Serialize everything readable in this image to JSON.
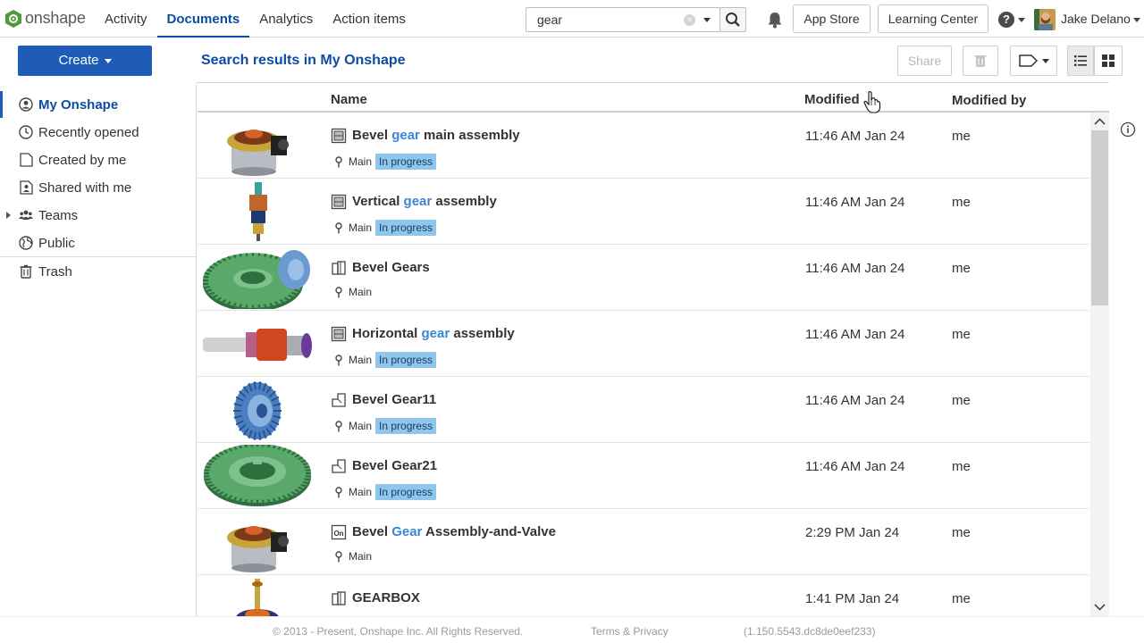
{
  "app": {
    "logo_text": "onshape"
  },
  "nav": [
    "Activity",
    "Documents",
    "Analytics",
    "Action items"
  ],
  "search": {
    "value": "gear",
    "clear_glyph": "×"
  },
  "topbar": {
    "app_store": "App Store",
    "learning_center": "Learning Center",
    "help_glyph": "?",
    "user_name": "Jake Delano"
  },
  "sidebar": {
    "create_label": "Create",
    "items": [
      "My Onshape",
      "Recently opened",
      "Created by me",
      "Shared with me",
      "Teams",
      "Public",
      "Trash"
    ]
  },
  "main": {
    "title": "Search results in My Onshape",
    "share_label": "Share",
    "columns": {
      "name": "Name",
      "modified": "Modified",
      "modified_by": "Modified by"
    }
  },
  "rows": [
    {
      "name_parts": [
        "Bevel ",
        "gear",
        " main assembly"
      ],
      "type_icon": "assembly-doc-icon",
      "branch": "Main",
      "status": "In progress",
      "modified": "11:46 AM Jan 24",
      "modified_by": "me",
      "thumb": "gear-housing-assembly"
    },
    {
      "name_parts": [
        "Vertical ",
        "gear",
        " assembly"
      ],
      "type_icon": "assembly-doc-icon",
      "branch": "Main",
      "status": "In progress",
      "modified": "11:46 AM Jan 24",
      "modified_by": "me",
      "thumb": "vertical-shaft"
    },
    {
      "name_parts": [
        "Bevel Gears",
        "",
        ""
      ],
      "type_icon": "document-icon",
      "branch": "Main",
      "status": "",
      "modified": "11:46 AM Jan 24",
      "modified_by": "me",
      "thumb": "bevel-gear-pair"
    },
    {
      "name_parts": [
        "Horizontal ",
        "gear",
        " assembly"
      ],
      "type_icon": "assembly-doc-icon",
      "branch": "Main",
      "status": "In progress",
      "modified": "11:46 AM Jan 24",
      "modified_by": "me",
      "thumb": "horizontal-shaft"
    },
    {
      "name_parts": [
        "Bevel Gear11",
        "",
        ""
      ],
      "type_icon": "part-studio-icon",
      "branch": "Main",
      "status": "In progress",
      "modified": "11:46 AM Jan 24",
      "modified_by": "me",
      "thumb": "small-bevel-gear"
    },
    {
      "name_parts": [
        "Bevel Gear21",
        "",
        ""
      ],
      "type_icon": "part-studio-icon",
      "branch": "Main",
      "status": "In progress",
      "modified": "11:46 AM Jan 24",
      "modified_by": "me",
      "thumb": "ring-gear"
    },
    {
      "name_parts": [
        "Bevel ",
        "Gear",
        " Assembly-and-Valve"
      ],
      "type_icon": "onshape-doc-icon",
      "branch": "Main",
      "status": "",
      "modified": "2:29 PM Jan 24",
      "modified_by": "me",
      "thumb": "gear-housing-assembly"
    },
    {
      "name_parts": [
        "GEARBOX",
        "",
        ""
      ],
      "type_icon": "document-icon",
      "branch": "",
      "status": "",
      "modified": "1:41 PM Jan 24",
      "modified_by": "me",
      "thumb": "gearbox"
    }
  ],
  "footer": {
    "copyright": "© 2013 - Present, Onshape Inc. All Rights Reserved.",
    "terms": "Terms & Privacy",
    "version": "(1.150.5543.dc8de0eef233)"
  },
  "colors": {
    "accent": "#0c4da2",
    "create_button": "#1f5cb8",
    "highlight": "#3a86d6",
    "badge": "#8fc6ee"
  }
}
